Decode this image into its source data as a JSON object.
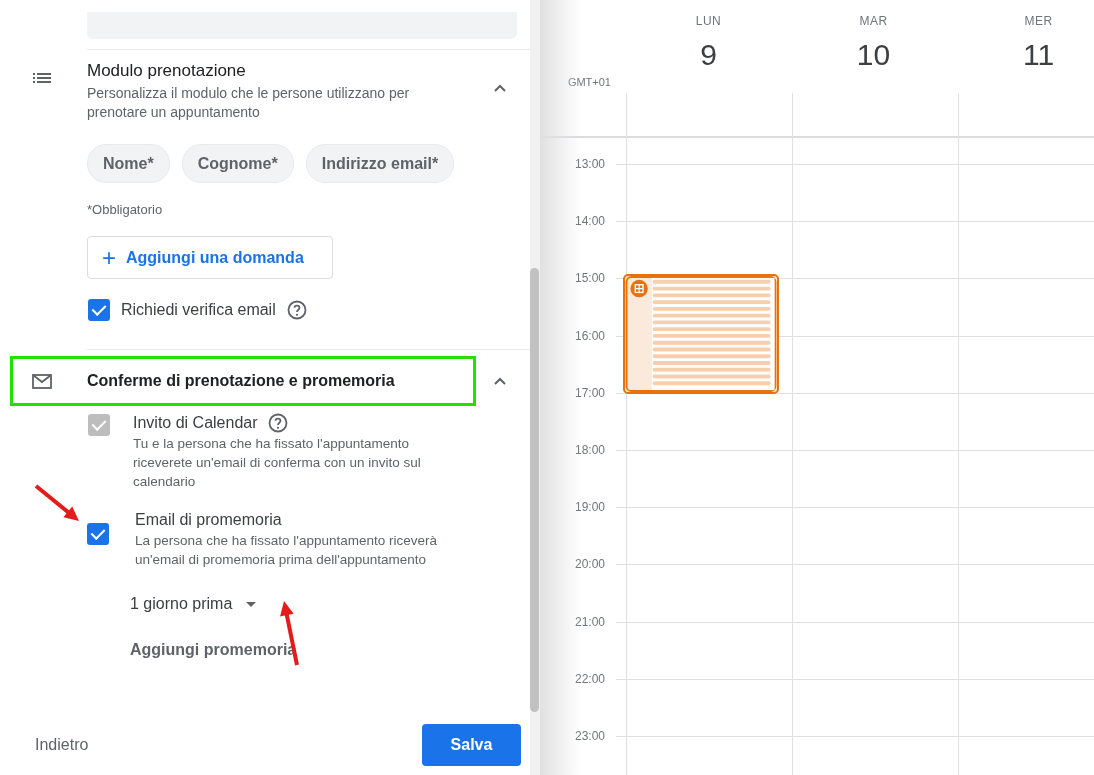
{
  "booking_form": {
    "sections": [
      {
        "kind": "form",
        "title": "Modulo prenotazione",
        "description": "Personalizza il modulo che le persone utilizzano per prenotare un appuntamento",
        "expanded": true,
        "highlighted": false
      },
      {
        "kind": "confirm",
        "title": "Conferme di prenotazione e promemoria",
        "expanded": true,
        "highlighted": true
      }
    ],
    "fields": [
      "Nome*",
      "Cognome*",
      "Indirizzo email*"
    ],
    "required_note": "*Obbligatorio",
    "add_question_button": {
      "icon": "+",
      "label": "Aggiungi una domanda"
    },
    "email_verification": {
      "label": "Richiedi verifica email",
      "checked": true
    },
    "options": [
      {
        "title": "Invito di Calendar",
        "description": "Tu e la persona che ha fissato l'appuntamento riceverete un'email di conferma con un invito sul calendario",
        "checked": true,
        "disabled": true,
        "help": true,
        "annotated": false
      },
      {
        "title": "Email di promemoria",
        "description": "La persona che ha fissato l'appuntamento riceverà un'email di promemoria prima dell'appuntamento",
        "checked": true,
        "disabled": false,
        "help": false,
        "annotated": true
      }
    ],
    "reminder_dropdown": {
      "value": "1 giorno prima",
      "annotated": true
    },
    "add_reminder_link": "Aggiungi promemoria",
    "back_button": "Indietro",
    "save_button": "Salva"
  },
  "calendar": {
    "timezone": "GMT+01",
    "days": [
      {
        "weekday": "LUN",
        "date": "9"
      },
      {
        "weekday": "MAR",
        "date": "10"
      },
      {
        "weekday": "MER",
        "date": "11"
      }
    ],
    "hours": [
      "13:00",
      "14:00",
      "15:00",
      "16:00",
      "17:00",
      "18:00",
      "19:00",
      "20:00",
      "21:00",
      "22:00",
      "23:00"
    ]
  }
}
